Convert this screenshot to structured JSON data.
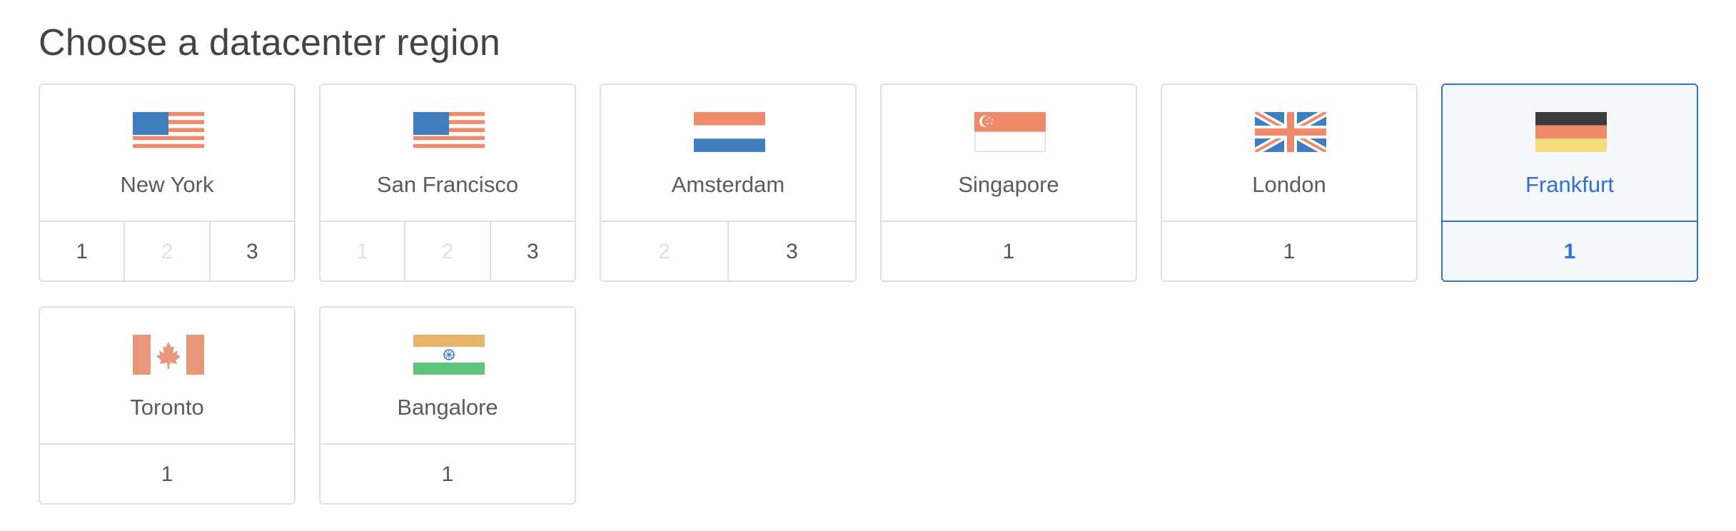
{
  "title": "Choose a datacenter region",
  "regions": [
    {
      "name": "New York",
      "flag": "us-flag-icon",
      "datacenters": [
        {
          "label": "1",
          "enabled": true
        },
        {
          "label": "2",
          "enabled": false
        },
        {
          "label": "3",
          "enabled": true
        }
      ],
      "selected": false
    },
    {
      "name": "San Francisco",
      "flag": "us-flag-icon",
      "datacenters": [
        {
          "label": "1",
          "enabled": false
        },
        {
          "label": "2",
          "enabled": false
        },
        {
          "label": "3",
          "enabled": true
        }
      ],
      "selected": false
    },
    {
      "name": "Amsterdam",
      "flag": "netherlands-flag-icon",
      "datacenters": [
        {
          "label": "2",
          "enabled": false
        },
        {
          "label": "3",
          "enabled": true
        }
      ],
      "selected": false
    },
    {
      "name": "Singapore",
      "flag": "singapore-flag-icon",
      "datacenters": [
        {
          "label": "1",
          "enabled": true
        }
      ],
      "selected": false
    },
    {
      "name": "London",
      "flag": "uk-flag-icon",
      "datacenters": [
        {
          "label": "1",
          "enabled": true
        }
      ],
      "selected": false
    },
    {
      "name": "Frankfurt",
      "flag": "germany-flag-icon",
      "datacenters": [
        {
          "label": "1",
          "enabled": true
        }
      ],
      "selected": true
    },
    {
      "name": "Toronto",
      "flag": "canada-flag-icon",
      "datacenters": [
        {
          "label": "1",
          "enabled": true
        }
      ],
      "selected": false
    },
    {
      "name": "Bangalore",
      "flag": "india-flag-icon",
      "datacenters": [
        {
          "label": "1",
          "enabled": true
        }
      ],
      "selected": false
    }
  ],
  "colors": {
    "accent": "#2f6fde",
    "border": "#e0e0e0",
    "flag_blue": "#3f7fbf",
    "flag_salmon": "#ef8a6b",
    "flag_dark": "#3c3c3c",
    "flag_yellow": "#f6dc7a",
    "flag_orange": "#e8b46a",
    "flag_green": "#5fc57a",
    "flag_canada": "#e9967a"
  }
}
